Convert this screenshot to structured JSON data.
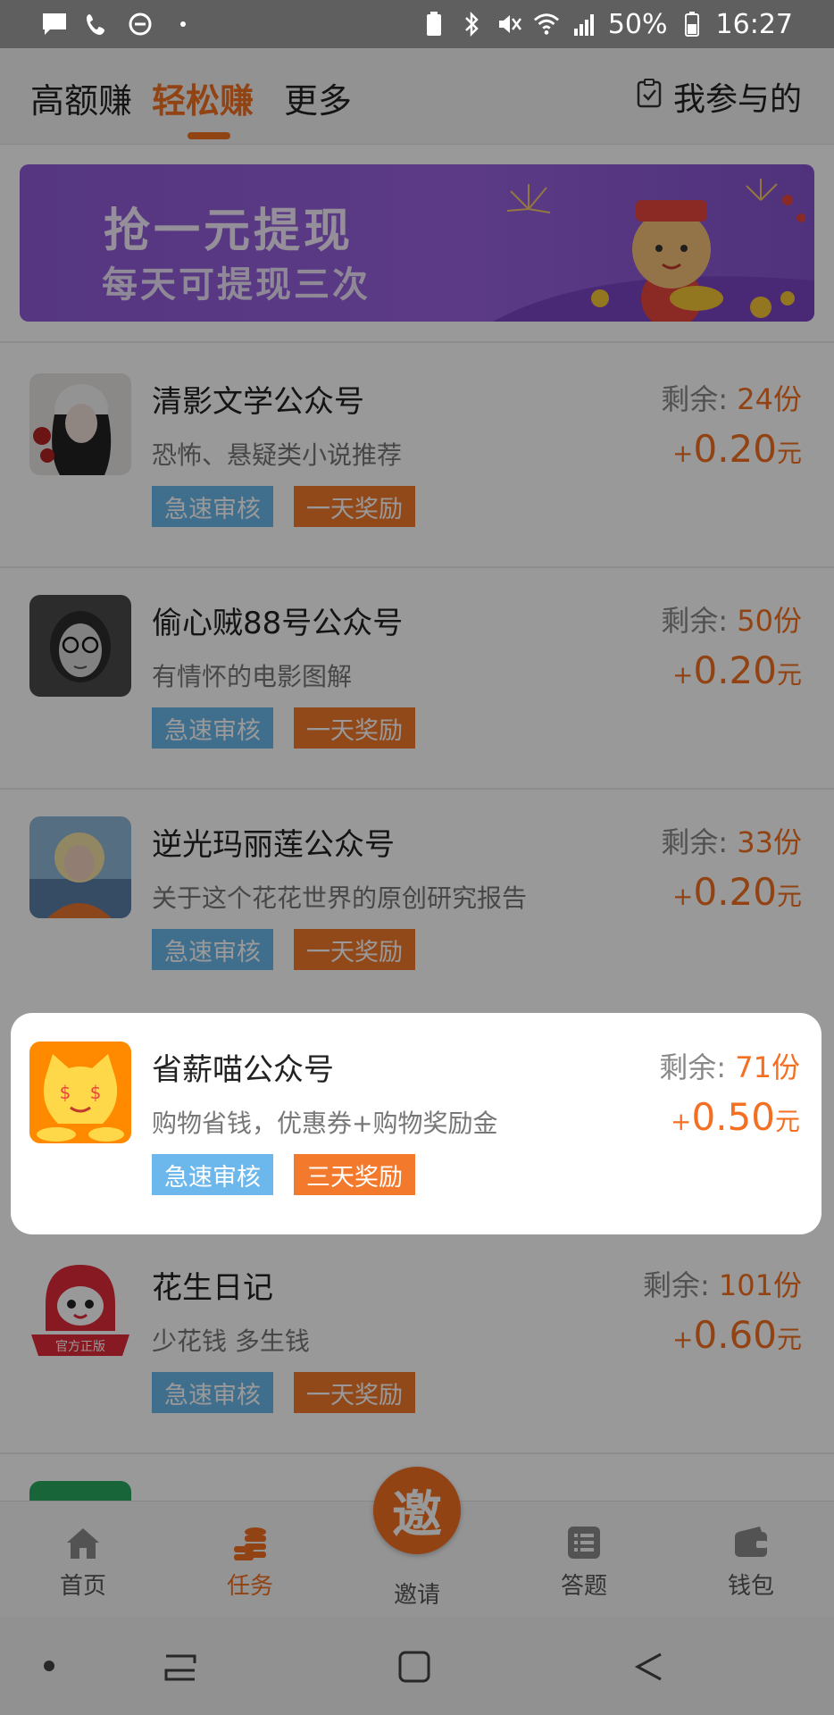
{
  "status": {
    "battery": "50%",
    "time": "16:27"
  },
  "tabs": [
    {
      "label": "高额赚"
    },
    {
      "label": "轻松赚"
    },
    {
      "label": "更多"
    }
  ],
  "participated_label": "我参与的",
  "banner": {
    "line1": "抢一元提现",
    "line2": "每天可提现三次"
  },
  "remain_prefix": "剩余: ",
  "reward_plus": "+",
  "reward_unit": "元",
  "tasks": [
    {
      "title": "清影文学公众号",
      "desc": "恐怖、悬疑类小说推荐",
      "remain": "24份",
      "reward": "0.20",
      "tag1": "急速审核",
      "tag2": "一天奖励"
    },
    {
      "title": "偷心贼88号公众号",
      "desc": "有情怀的电影图解",
      "remain": "50份",
      "reward": "0.20",
      "tag1": "急速审核",
      "tag2": "一天奖励"
    },
    {
      "title": "逆光玛丽莲公众号",
      "desc": "关于这个花花世界的原创研究报告",
      "remain": "33份",
      "reward": "0.20",
      "tag1": "急速审核",
      "tag2": "一天奖励"
    },
    {
      "title": "省薪喵公众号",
      "desc": "购物省钱，优惠券+购物奖励金",
      "remain": "71份",
      "reward": "0.50",
      "tag1": "急速审核",
      "tag2": "三天奖励"
    },
    {
      "title": "花生日记",
      "desc": "少花钱 多生钱",
      "remain": "101份",
      "reward": "0.60",
      "tag1": "急速审核",
      "tag2": "一天奖励",
      "badge": "官方正版"
    }
  ],
  "nav": [
    {
      "label": "首页"
    },
    {
      "label": "任务"
    },
    {
      "label": "邀请"
    },
    {
      "label": "答题"
    },
    {
      "label": "钱包"
    }
  ],
  "invite_glyph": "邀",
  "colors": {
    "accent": "#f37022",
    "tag_blue": "#6cb8ec",
    "tag_orange": "#f37a2c",
    "banner": "#9a62e0"
  }
}
